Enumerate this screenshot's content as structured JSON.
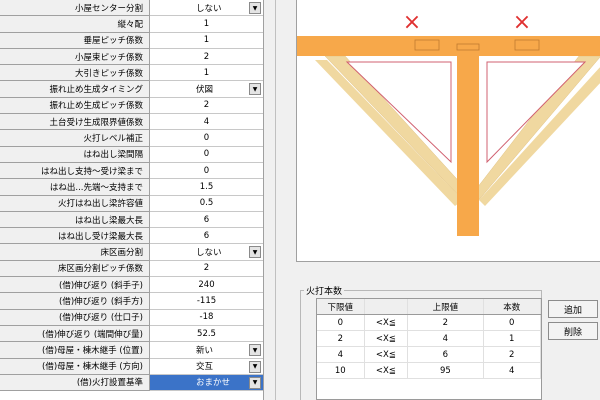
{
  "property_grid": {
    "rows": [
      {
        "label": "小屋センター分割",
        "value": "しない",
        "type": "combo"
      },
      {
        "label": "縦々配",
        "value": "1",
        "type": "number"
      },
      {
        "label": "垂屋ピッチ係数",
        "value": "1",
        "type": "number"
      },
      {
        "label": "小屋束ピッチ係数",
        "value": "2",
        "type": "number"
      },
      {
        "label": "大引きピッチ係数",
        "value": "1",
        "type": "number"
      },
      {
        "label": "振れ止め生成タイミング",
        "value": "伏図",
        "type": "combo"
      },
      {
        "label": "振れ止め生成ピッチ係数",
        "value": "2",
        "type": "number"
      },
      {
        "label": "土台受け生成限界値係数",
        "value": "4",
        "type": "number"
      },
      {
        "label": "火打レベル補正",
        "value": "0",
        "type": "number"
      },
      {
        "label": "はね出し梁間隔",
        "value": "0",
        "type": "number"
      },
      {
        "label": "はね出し支持～受け梁まで",
        "value": "0",
        "type": "number"
      },
      {
        "label": "はね出...先端～支持まで",
        "value": "1.5",
        "type": "number"
      },
      {
        "label": "火打はね出し梁許容値",
        "value": "0.5",
        "type": "number"
      },
      {
        "label": "はね出し梁最大長",
        "value": "6",
        "type": "number"
      },
      {
        "label": "はね出し受け梁最大長",
        "value": "6",
        "type": "number"
      },
      {
        "label": "床区画分割",
        "value": "しない",
        "type": "combo"
      },
      {
        "label": "床区画分割ピッチ係数",
        "value": "2",
        "type": "number"
      },
      {
        "label": "(借)伸び返り (斜手子)",
        "value": "240",
        "type": "number"
      },
      {
        "label": "(借)伸び返り (斜手方)",
        "value": "-115",
        "type": "number"
      },
      {
        "label": "(借)伸び返り (仕口子)",
        "value": "-18",
        "type": "number"
      },
      {
        "label": "(借)伸び返り (端間伸び量)",
        "value": "52.5",
        "type": "number"
      },
      {
        "label": "(借)母屋・棟木継手 (位置)",
        "value": "新い",
        "type": "combo"
      },
      {
        "label": "(借)母屋・棟木継手 (方向)",
        "value": "交互",
        "type": "combo"
      },
      {
        "label": "(借)火打設置基準",
        "value": "おまかせ",
        "type": "combo",
        "selected": true
      }
    ]
  },
  "count_section": {
    "title": "火打本数",
    "headers": [
      "下限値",
      "",
      "上限値",
      "本数"
    ],
    "rows": [
      [
        "0",
        "<X≦",
        "2",
        "0"
      ],
      [
        "2",
        "<X≦",
        "4",
        "1"
      ],
      [
        "4",
        "<X≦",
        "6",
        "2"
      ],
      [
        "10",
        "<X≦",
        "95",
        "4"
      ]
    ],
    "add_label": "追加",
    "delete_label": "削除"
  },
  "diagram": {
    "marker_symbol": "×",
    "colors": {
      "beam": "#f7a84a",
      "brace": "#f0d8a0",
      "marker": "#e03030",
      "outline": "#d06070"
    }
  }
}
